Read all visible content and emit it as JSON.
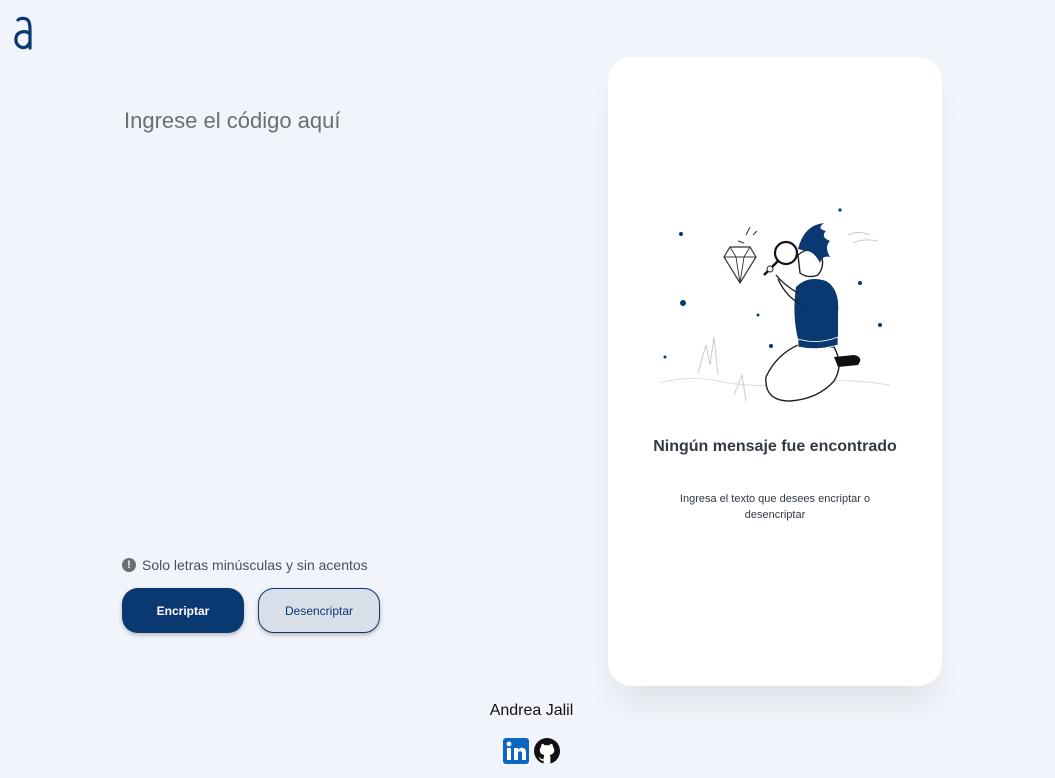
{
  "logo": {
    "icon": "alura-logo-icon"
  },
  "input": {
    "placeholder": "Ingrese el código aquí",
    "value": ""
  },
  "hint": {
    "icon": "exclamation-circle-icon",
    "text": "Solo letras minúsculas y sin acentos"
  },
  "buttons": {
    "encrypt": "Encriptar",
    "decrypt": "Desencriptar"
  },
  "card": {
    "illustration": "person-with-magnifier-illustration",
    "title": "Ningún mensaje fue encontrado",
    "text": "Ingresa el texto que desees encriptar o desencriptar"
  },
  "footer": {
    "author": "Andrea Jalil",
    "links": [
      {
        "icon": "linkedin-icon"
      },
      {
        "icon": "github-icon"
      }
    ]
  },
  "colors": {
    "background": "#f1f4fa",
    "primary": "#0a3871",
    "secondary_bg": "#d8dfe8",
    "card": "#ffffff"
  }
}
